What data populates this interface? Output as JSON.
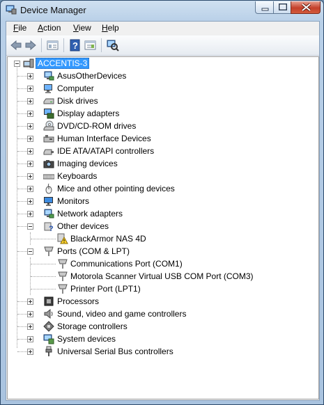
{
  "window": {
    "title": "Device Manager"
  },
  "menu": [
    {
      "label": "File",
      "accel": "F",
      "rest": "ile"
    },
    {
      "label": "Action",
      "accel": "A",
      "rest": "ction"
    },
    {
      "label": "View",
      "accel": "V",
      "rest": "iew"
    },
    {
      "label": "Help",
      "accel": "H",
      "rest": "elp"
    }
  ],
  "tree": {
    "root": "ACCENTIS-3",
    "categories": [
      {
        "label": "AsusOtherDevices",
        "icon": "network-icon",
        "expanded": false
      },
      {
        "label": "Computer",
        "icon": "computer-icon",
        "expanded": false
      },
      {
        "label": "Disk drives",
        "icon": "disk-drive-icon",
        "expanded": false
      },
      {
        "label": "Display adapters",
        "icon": "display-adapter-icon",
        "expanded": false
      },
      {
        "label": "DVD/CD-ROM drives",
        "icon": "dvd-drive-icon",
        "expanded": false
      },
      {
        "label": "Human Interface Devices",
        "icon": "hid-icon",
        "expanded": false
      },
      {
        "label": "IDE ATA/ATAPI controllers",
        "icon": "ide-controller-icon",
        "expanded": false
      },
      {
        "label": "Imaging devices",
        "icon": "camera-icon",
        "expanded": false
      },
      {
        "label": "Keyboards",
        "icon": "keyboard-icon",
        "expanded": false
      },
      {
        "label": "Mice and other pointing devices",
        "icon": "mouse-icon",
        "expanded": false
      },
      {
        "label": "Monitors",
        "icon": "monitor-icon",
        "expanded": false
      },
      {
        "label": "Network adapters",
        "icon": "network-icon",
        "expanded": false
      },
      {
        "label": "Other devices",
        "icon": "unknown-device-icon",
        "expanded": true,
        "children": [
          {
            "label": "BlackArmor NAS 4D",
            "icon": "warning-device-icon"
          }
        ]
      },
      {
        "label": "Ports (COM & LPT)",
        "icon": "port-icon",
        "expanded": true,
        "children": [
          {
            "label": "Communications Port (COM1)",
            "icon": "port-icon"
          },
          {
            "label": "Motorola Scanner Virtual USB COM Port (COM3)",
            "icon": "port-icon"
          },
          {
            "label": "Printer Port (LPT1)",
            "icon": "port-icon"
          }
        ]
      },
      {
        "label": "Processors",
        "icon": "processor-icon",
        "expanded": false
      },
      {
        "label": "Sound, video and game controllers",
        "icon": "speaker-icon",
        "expanded": false
      },
      {
        "label": "Storage controllers",
        "icon": "storage-controller-icon",
        "expanded": false
      },
      {
        "label": "System devices",
        "icon": "system-device-icon",
        "expanded": false
      },
      {
        "label": "Universal Serial Bus controllers",
        "icon": "usb-icon",
        "expanded": false
      }
    ]
  }
}
